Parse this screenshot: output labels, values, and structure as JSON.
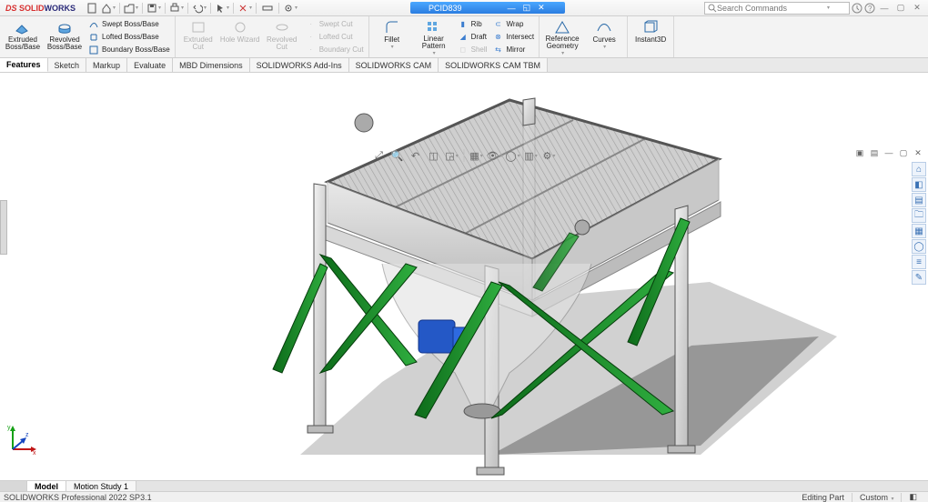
{
  "app": {
    "name": "SOLIDWORKS",
    "doc_title": "PCID839"
  },
  "search": {
    "placeholder": "Search Commands"
  },
  "ribbon": {
    "g1": {
      "extrude": "Extruded Boss/Base",
      "revolve": "Revolved Boss/Base",
      "swept": "Swept Boss/Base",
      "lofted": "Lofted Boss/Base",
      "boundary": "Boundary Boss/Base"
    },
    "g2": {
      "ext_cut": "Extruded Cut",
      "hole": "Hole Wizard",
      "rev_cut": "Revolved Cut",
      "swept_cut": "Swept Cut",
      "lofted_cut": "Lofted Cut",
      "boundary_cut": "Boundary Cut"
    },
    "g3": {
      "fillet": "Fillet",
      "linpat": "Linear Pattern",
      "rib": "Rib",
      "draft": "Draft",
      "shell": "Shell",
      "wrap": "Wrap",
      "intersect": "Intersect",
      "mirror": "Mirror"
    },
    "g4": {
      "refgeom": "Reference Geometry",
      "curves": "Curves"
    },
    "g5": {
      "instant3d": "Instant3D"
    }
  },
  "fm_tabs": [
    "Features",
    "Sketch",
    "Markup",
    "Evaluate",
    "MBD Dimensions",
    "SOLIDWORKS Add-Ins",
    "SOLIDWORKS CAM",
    "SOLIDWORKS CAM TBM"
  ],
  "fm_active": 0,
  "bottom": {
    "tabs": [
      "Model",
      "Motion Study 1"
    ],
    "active": 0
  },
  "status": {
    "version": "SOLIDWORKS Professional 2022 SP3.1",
    "mode": "Editing Part",
    "units": "Custom"
  }
}
